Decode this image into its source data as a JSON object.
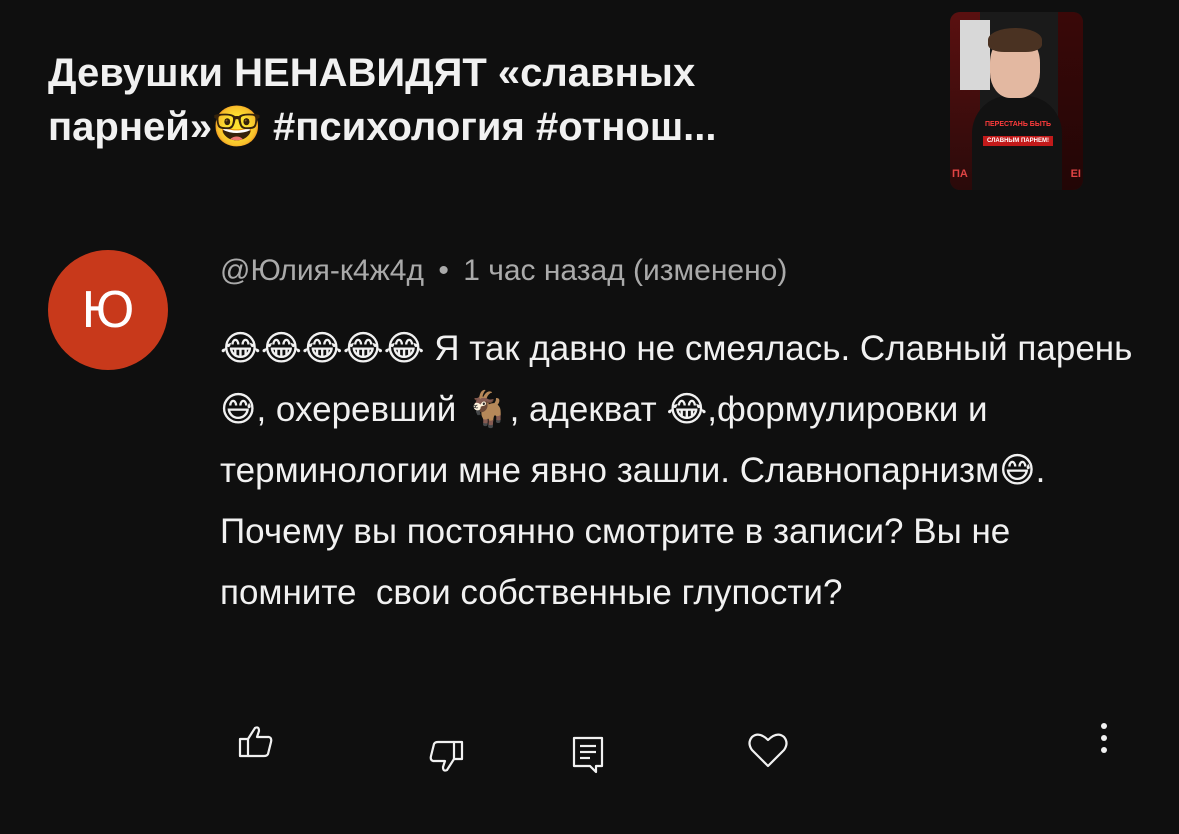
{
  "video": {
    "title": "Девушки НЕНАВИДЯТ «славных парней»🤓 #психология #отнош...",
    "thumbnail_caption_line1": "ПЕРЕСТАНЬ БЫТЬ",
    "thumbnail_caption_line2": "СЛАВНЫМ ПАРНЕМ!",
    "thumbnail_left_text": "ПА",
    "thumbnail_right_text": "ЕІ"
  },
  "comment": {
    "avatar_letter": "Ю",
    "avatar_color": "#c8391b",
    "author": "@Юлия-к4ж4д",
    "separator": "•",
    "time": "1 час назад (изменено)",
    "text": "😂😂😂😂😂 Я так давно не смеялась. Славный парень😅, охеревший 🐐, адекват 😂,формулировки и терминологии мне явно зашли. Славнопарнизм😅. Почему вы постоянно смотрите в записи? Вы не помните  свои собственные глупости?"
  },
  "actions": {
    "like_icon": "thumbs-up-icon",
    "dislike_icon": "thumbs-down-icon",
    "reply_icon": "reply-icon",
    "heart_icon": "heart-icon",
    "more_icon": "more-vertical-icon"
  }
}
